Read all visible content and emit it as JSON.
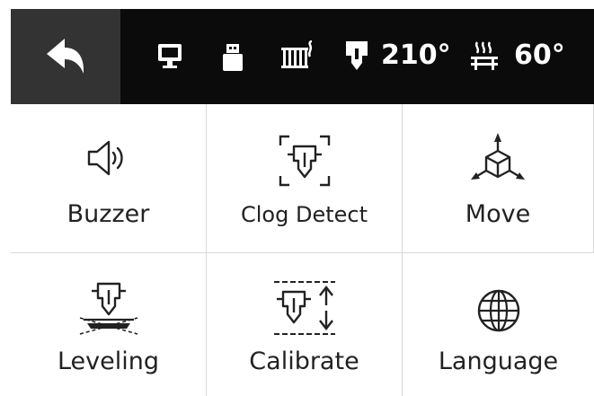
{
  "status_bar": {
    "back_icon": "back-arrow-icon",
    "icons": [
      "monitor-icon",
      "usb-drive-icon",
      "chamber-heater-icon"
    ],
    "nozzle_temp": "210°",
    "bed_temp": "60°"
  },
  "menu": {
    "items": [
      {
        "label": "Buzzer",
        "icon": "speaker-icon"
      },
      {
        "label": "Clog Detect",
        "icon": "nozzle-detect-icon"
      },
      {
        "label": "Move",
        "icon": "axes-move-icon"
      },
      {
        "label": "Leveling",
        "icon": "bed-leveling-icon"
      },
      {
        "label": "Calibrate",
        "icon": "calibrate-icon"
      },
      {
        "label": "Language",
        "icon": "globe-icon"
      }
    ]
  },
  "colors": {
    "top_bar": "#0b0b0b",
    "back_button": "#333333",
    "divider": "#d8d8d8",
    "text": "#222222"
  }
}
